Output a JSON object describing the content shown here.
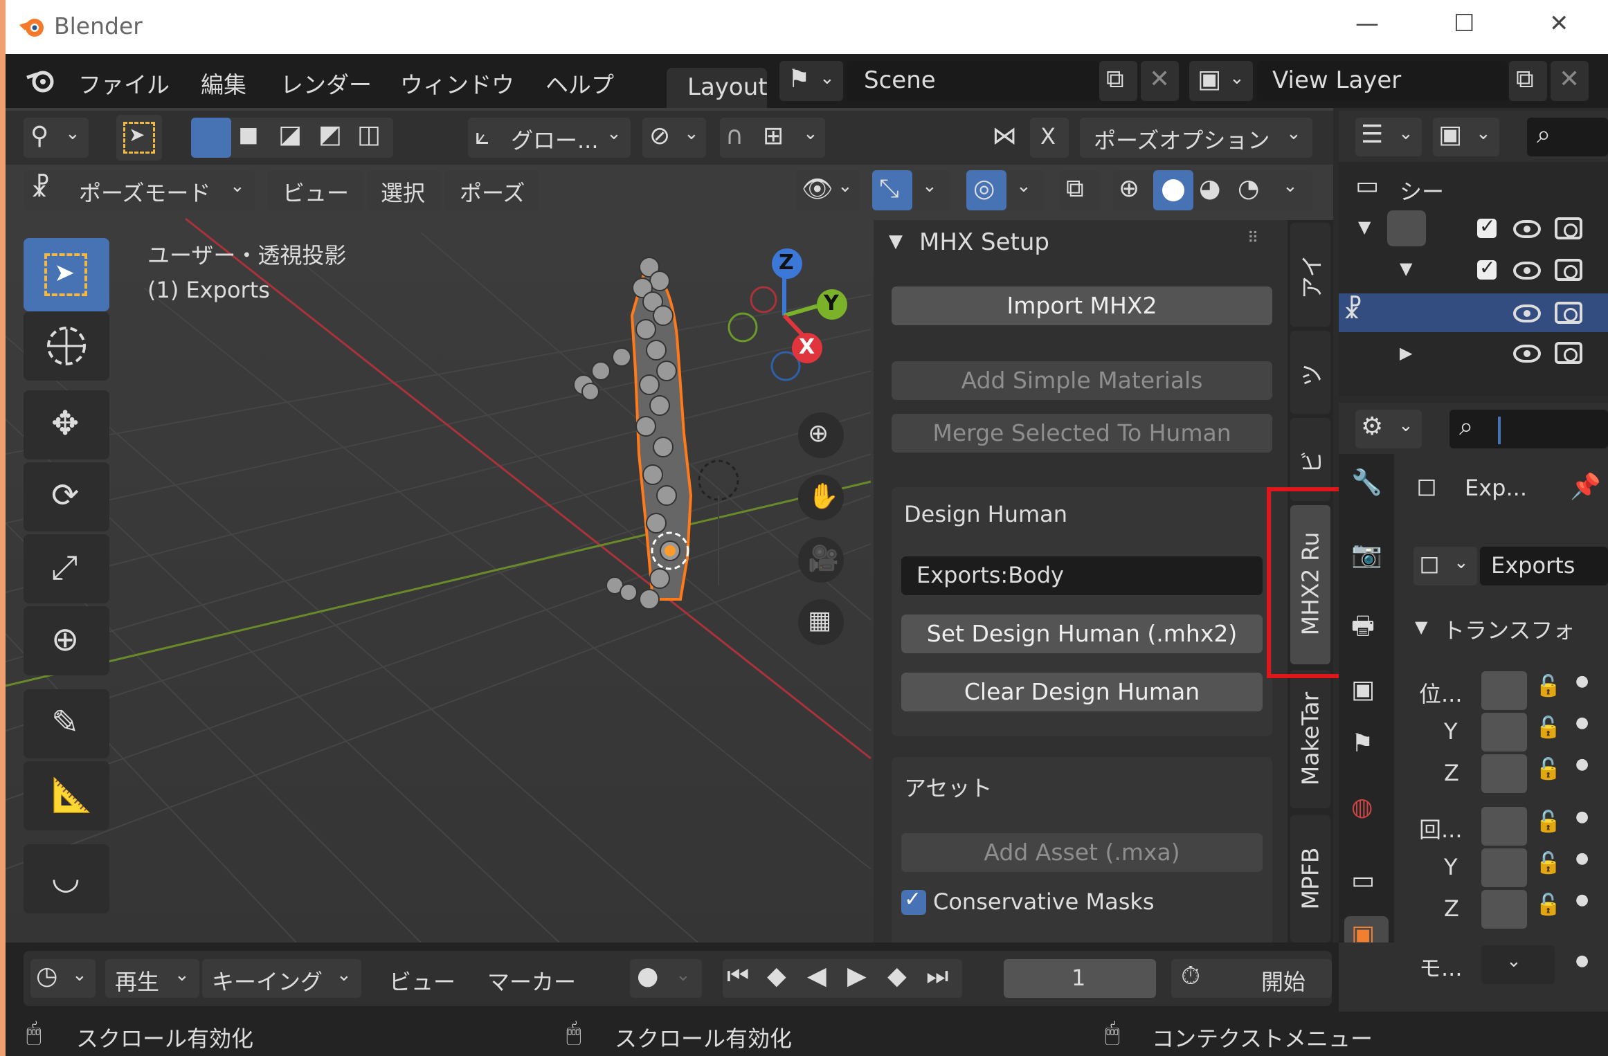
{
  "window": {
    "title": "Blender",
    "minimize": "—",
    "maximize": "☐",
    "close": "✕"
  },
  "menu": {
    "items": [
      "ファイル",
      "編集",
      "レンダー",
      "ウィンドウ",
      "ヘルプ"
    ]
  },
  "workspace_tab": "Layout",
  "scene": {
    "name": "Scene",
    "clear": "✕"
  },
  "view_layer": {
    "name": "View Layer",
    "clear": "✕"
  },
  "viewport_header": {
    "transform_orientation": "グロー...",
    "pose_options": "ポーズオプション",
    "x_mirror": "X",
    "mode": "ポーズモード",
    "menus": [
      "ビュー",
      "選択",
      "ポーズ"
    ]
  },
  "viewport": {
    "info_line1": "ユーザー・透視投影",
    "info_line2": "(1) Exports"
  },
  "gizmo": {
    "x": "X",
    "y": "Y",
    "z": "Z"
  },
  "sidebar_panel": {
    "title": "MHX Setup",
    "buttons": [
      "Import MHX2",
      "Add Simple Materials",
      "Merge Selected To Human"
    ],
    "design_human": {
      "header": "Design Human",
      "field_value": "Exports:Body",
      "set_button": "Set Design Human (.mhx2)",
      "clear_button": "Clear Design Human"
    },
    "asset": {
      "header": "アセット",
      "add_asset": "Add Asset (.mxa)",
      "conservative_masks": "Conservative Masks"
    }
  },
  "sidebar_tabs": [
    "アイ",
    "ツ",
    "ビ",
    "MHX2 Ru",
    "MakeTar",
    "MPFB"
  ],
  "outliner": {
    "scene_label": "シー"
  },
  "properties": {
    "object_name": "Exp...",
    "data_name": "Exports",
    "transform_header": "トランスフォ",
    "loc_label": "位...",
    "rot_label": "回...",
    "mode_label": "モ...",
    "y": "Y",
    "z": "Z"
  },
  "timeline": {
    "menus": [
      "再生",
      "キーイング",
      "ビュー",
      "マーカー"
    ],
    "frame": "1",
    "start_label": "開始"
  },
  "statusbar": {
    "items": [
      "スクロール有効化",
      "スクロール有効化",
      "コンテクストメニュー"
    ]
  },
  "colors": {
    "accent": "#4772b3",
    "highlight_box": "#e0161b",
    "selection_orange": "#ff8a2a"
  }
}
